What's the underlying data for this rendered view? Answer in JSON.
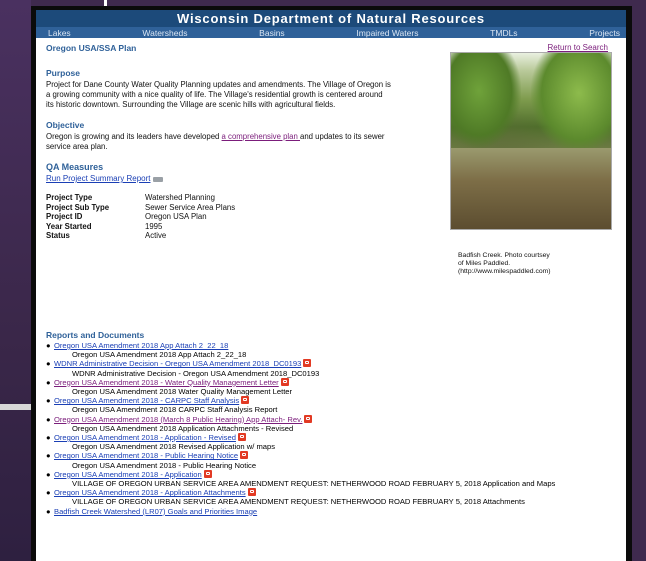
{
  "header": {
    "title": "Wisconsin Department of Natural Resources"
  },
  "nav": [
    "Lakes",
    "Watersheds",
    "Basins",
    "Impaired Waters",
    "TMDLs",
    "Projects"
  ],
  "plan": {
    "title": "Oregon USA/SSA Plan",
    "return_label": "Return to Search"
  },
  "purpose": {
    "heading": "Purpose",
    "text": "Project for Dane County Water Quality Planning updates and amendments. The Village of Oregon is a growing community with a nice quality of life. The Village's residential growth is centered around its historic downtown. Surrounding the Village are scenic hills with agricultural fields."
  },
  "objective": {
    "heading": "Objective",
    "text_before": "Oregon is growing and its leaders have developed ",
    "link": "a comprehensive plan ",
    "text_after": "and updates to its sewer service area plan."
  },
  "qa": {
    "heading": "QA Measures",
    "link": "Run Project Summary Report"
  },
  "info": [
    {
      "key": "Project Type",
      "value": "Watershed Planning"
    },
    {
      "key": "Project Sub Type",
      "value": "Sewer Service Area Plans"
    },
    {
      "key": "Project ID",
      "value": "Oregon USA Plan"
    },
    {
      "key": "Year Started",
      "value": "1995"
    },
    {
      "key": "Status",
      "value": "Active"
    }
  ],
  "photo": {
    "caption_1": "Badfish Creek. Photo courtsey",
    "caption_2": "of Miles Paddled.",
    "caption_3": "(http://www.milespaddled.com)"
  },
  "reports": {
    "heading": "Reports and Documents",
    "items": [
      {
        "link": "Oregon USA Amendment 2018 App Attach 2_22_18",
        "desc": "Oregon USA Amendment 2018 App Attach 2_22_18"
      },
      {
        "link": "WDNR Administrative Decision - Oregon USA Amendment 2018_DC0193",
        "desc": "WDNR Administrative Decision - Oregon USA Amendment 2018_DC0193"
      },
      {
        "link": "Oregon USA Amendment 2018 - Water Quality Management Letter",
        "desc": "Oregon USA Amendment 2018 Water Quality Management Letter"
      },
      {
        "link": "Oregon USA Amendment 2018 - CARPC Staff Analysis",
        "desc": "Oregon USA Amendment 2018 CARPC Staff Analysis Report"
      },
      {
        "link": "Oregon USA Amendment 2018 (March 8 Public Hearing) App Attach- Rev.",
        "desc": "Oregon USA Amendment 2018 Application Attachments - Revised"
      },
      {
        "link": "Oregon USA Amendment 2018 - Application - Revised",
        "desc": "Oregon USA Amendment 2018 Revised Application w/ maps"
      },
      {
        "link": "Oregon USA Amendment 2018 - Public Hearing Notice",
        "desc": "Oregon USA Amendment 2018 - Public Hearing Notice"
      },
      {
        "link": "Oregon USA Amendment 2018 - Application",
        "desc": "VILLAGE OF OREGON URBAN SERVICE AREA AMENDMENT REQUEST: NETHERWOOD ROAD FEBRUARY 5, 2018 Application and Maps"
      },
      {
        "link": "Oregon USA Amendment 2018 - Application Attachments",
        "desc": "VILLAGE OF OREGON URBAN SERVICE AREA AMENDMENT REQUEST: NETHERWOOD ROAD FEBRUARY 5, 2018 Attachments"
      },
      {
        "link": "Badfish Creek Watershed (LR07) Goals and Priorities Image",
        "desc": ""
      }
    ]
  }
}
